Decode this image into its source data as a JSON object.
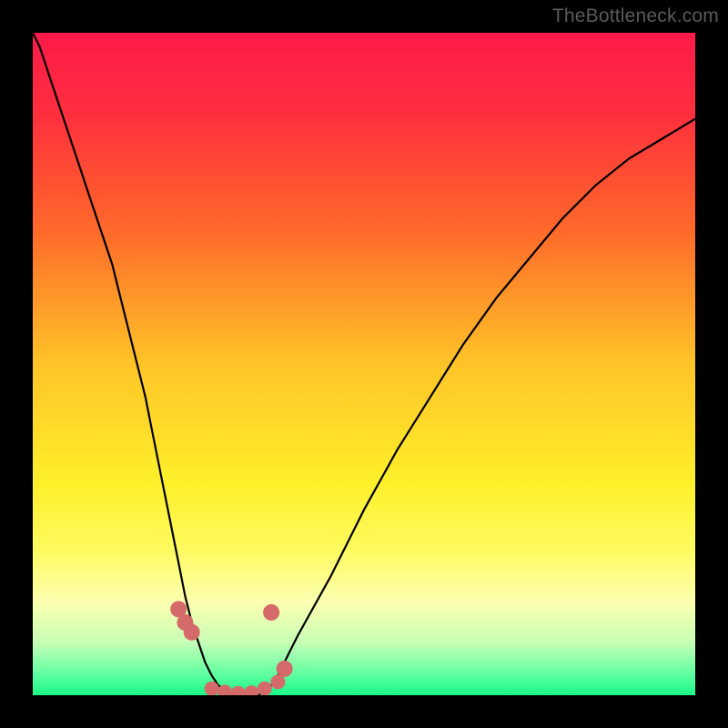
{
  "watermark": "TheBottleneck.com",
  "chart_data": {
    "type": "line",
    "title": "",
    "xlabel": "",
    "ylabel": "",
    "xlim": [
      0,
      100
    ],
    "ylim": [
      0,
      100
    ],
    "background_gradient": {
      "stops": [
        {
          "pos": 0.0,
          "color": "#ff1a4a"
        },
        {
          "pos": 0.12,
          "color": "#ff2e3e"
        },
        {
          "pos": 0.3,
          "color": "#ff6a2a"
        },
        {
          "pos": 0.5,
          "color": "#ffc428"
        },
        {
          "pos": 0.68,
          "color": "#fff02a"
        },
        {
          "pos": 0.78,
          "color": "#fffb60"
        },
        {
          "pos": 0.86,
          "color": "#fcffb0"
        },
        {
          "pos": 0.92,
          "color": "#c7ffb6"
        },
        {
          "pos": 0.97,
          "color": "#5cffa0"
        },
        {
          "pos": 1.0,
          "color": "#18f887"
        }
      ]
    },
    "series": [
      {
        "name": "curve",
        "color": "#000000",
        "x": [
          0,
          1,
          2,
          3,
          4,
          5,
          6,
          7,
          8,
          9,
          10,
          11,
          12,
          13,
          14,
          15,
          16,
          17,
          18,
          19,
          20,
          21,
          22,
          23,
          24,
          25,
          26,
          27,
          28,
          29,
          30,
          31,
          32,
          33,
          34,
          35,
          36,
          37,
          38,
          39,
          40,
          45,
          50,
          55,
          60,
          65,
          70,
          75,
          80,
          85,
          90,
          95,
          100
        ],
        "values": [
          100,
          98,
          95,
          92,
          89,
          86,
          83,
          80,
          77,
          74,
          71,
          68,
          65,
          61,
          57,
          53,
          49,
          45,
          40,
          35,
          30,
          25,
          20,
          15,
          11,
          8,
          5,
          3,
          1.5,
          0.8,
          0.3,
          0.1,
          0,
          0,
          0,
          0.5,
          1.5,
          3,
          5,
          7,
          9,
          18,
          28,
          37,
          45,
          53,
          60,
          66,
          72,
          77,
          81,
          84,
          87
        ]
      }
    ],
    "markers": [
      {
        "x": 22,
        "y_pct": 87,
        "color": "#d46a6a",
        "size": 9
      },
      {
        "x": 23,
        "y_pct": 89,
        "color": "#d46a6a",
        "size": 9
      },
      {
        "x": 24,
        "y_pct": 90.5,
        "color": "#d46a6a",
        "size": 9
      },
      {
        "x": 27,
        "y_pct": 99,
        "color": "#d46a6a",
        "size": 8
      },
      {
        "x": 29,
        "y_pct": 99.5,
        "color": "#d46a6a",
        "size": 8
      },
      {
        "x": 31,
        "y_pct": 99.7,
        "color": "#d46a6a",
        "size": 8
      },
      {
        "x": 33,
        "y_pct": 99.6,
        "color": "#d46a6a",
        "size": 8
      },
      {
        "x": 35,
        "y_pct": 99,
        "color": "#d46a6a",
        "size": 8
      },
      {
        "x": 37,
        "y_pct": 98,
        "color": "#d46a6a",
        "size": 8
      },
      {
        "x": 38,
        "y_pct": 96,
        "color": "#d46a6a",
        "size": 9
      },
      {
        "x": 36,
        "y_pct": 87.5,
        "color": "#d46a6a",
        "size": 9
      }
    ]
  }
}
